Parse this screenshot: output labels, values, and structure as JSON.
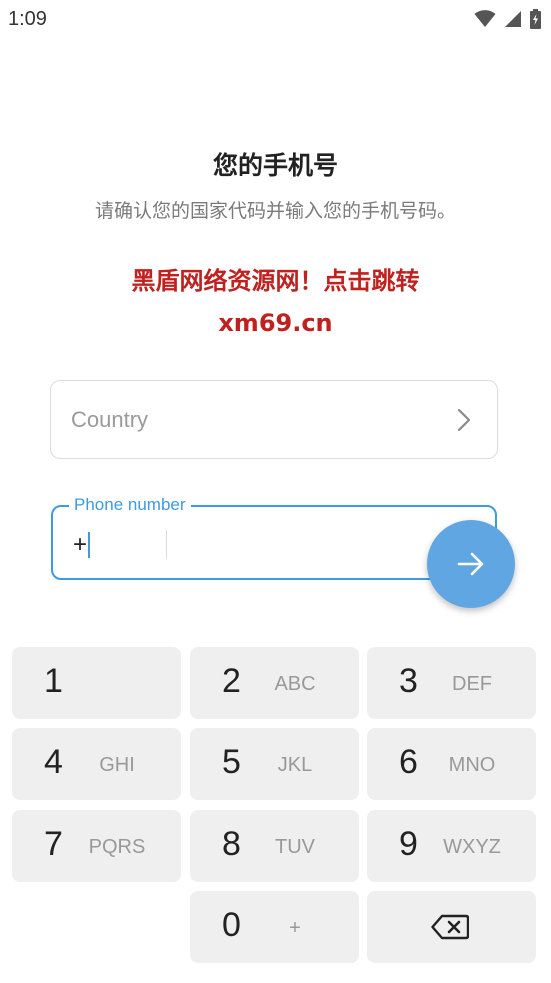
{
  "status": {
    "time": "1:09"
  },
  "header": {
    "title": "您的手机号",
    "subtitle": "请确认您的国家代码并输入您的手机号码。",
    "promo_line1": "黑盾网络资源网！点击跳转",
    "promo_line2": "xm69.cn"
  },
  "country": {
    "placeholder": "Country"
  },
  "phone": {
    "label": "Phone number",
    "code_prefix": "+",
    "number_value": ""
  },
  "colors": {
    "accent": "#3d9be0",
    "promo": "#c0211f",
    "fab": "#5fa6e3",
    "key_bg": "#efefef"
  },
  "keypad": {
    "keys": [
      {
        "digit": "1",
        "letters": ""
      },
      {
        "digit": "2",
        "letters": "ABC"
      },
      {
        "digit": "3",
        "letters": "DEF"
      },
      {
        "digit": "4",
        "letters": "GHI"
      },
      {
        "digit": "5",
        "letters": "JKL"
      },
      {
        "digit": "6",
        "letters": "MNO"
      },
      {
        "digit": "7",
        "letters": "PQRS"
      },
      {
        "digit": "8",
        "letters": "TUV"
      },
      {
        "digit": "9",
        "letters": "WXYZ"
      },
      {
        "digit": "0",
        "letters": "+"
      }
    ],
    "backspace_icon": "backspace-icon"
  }
}
